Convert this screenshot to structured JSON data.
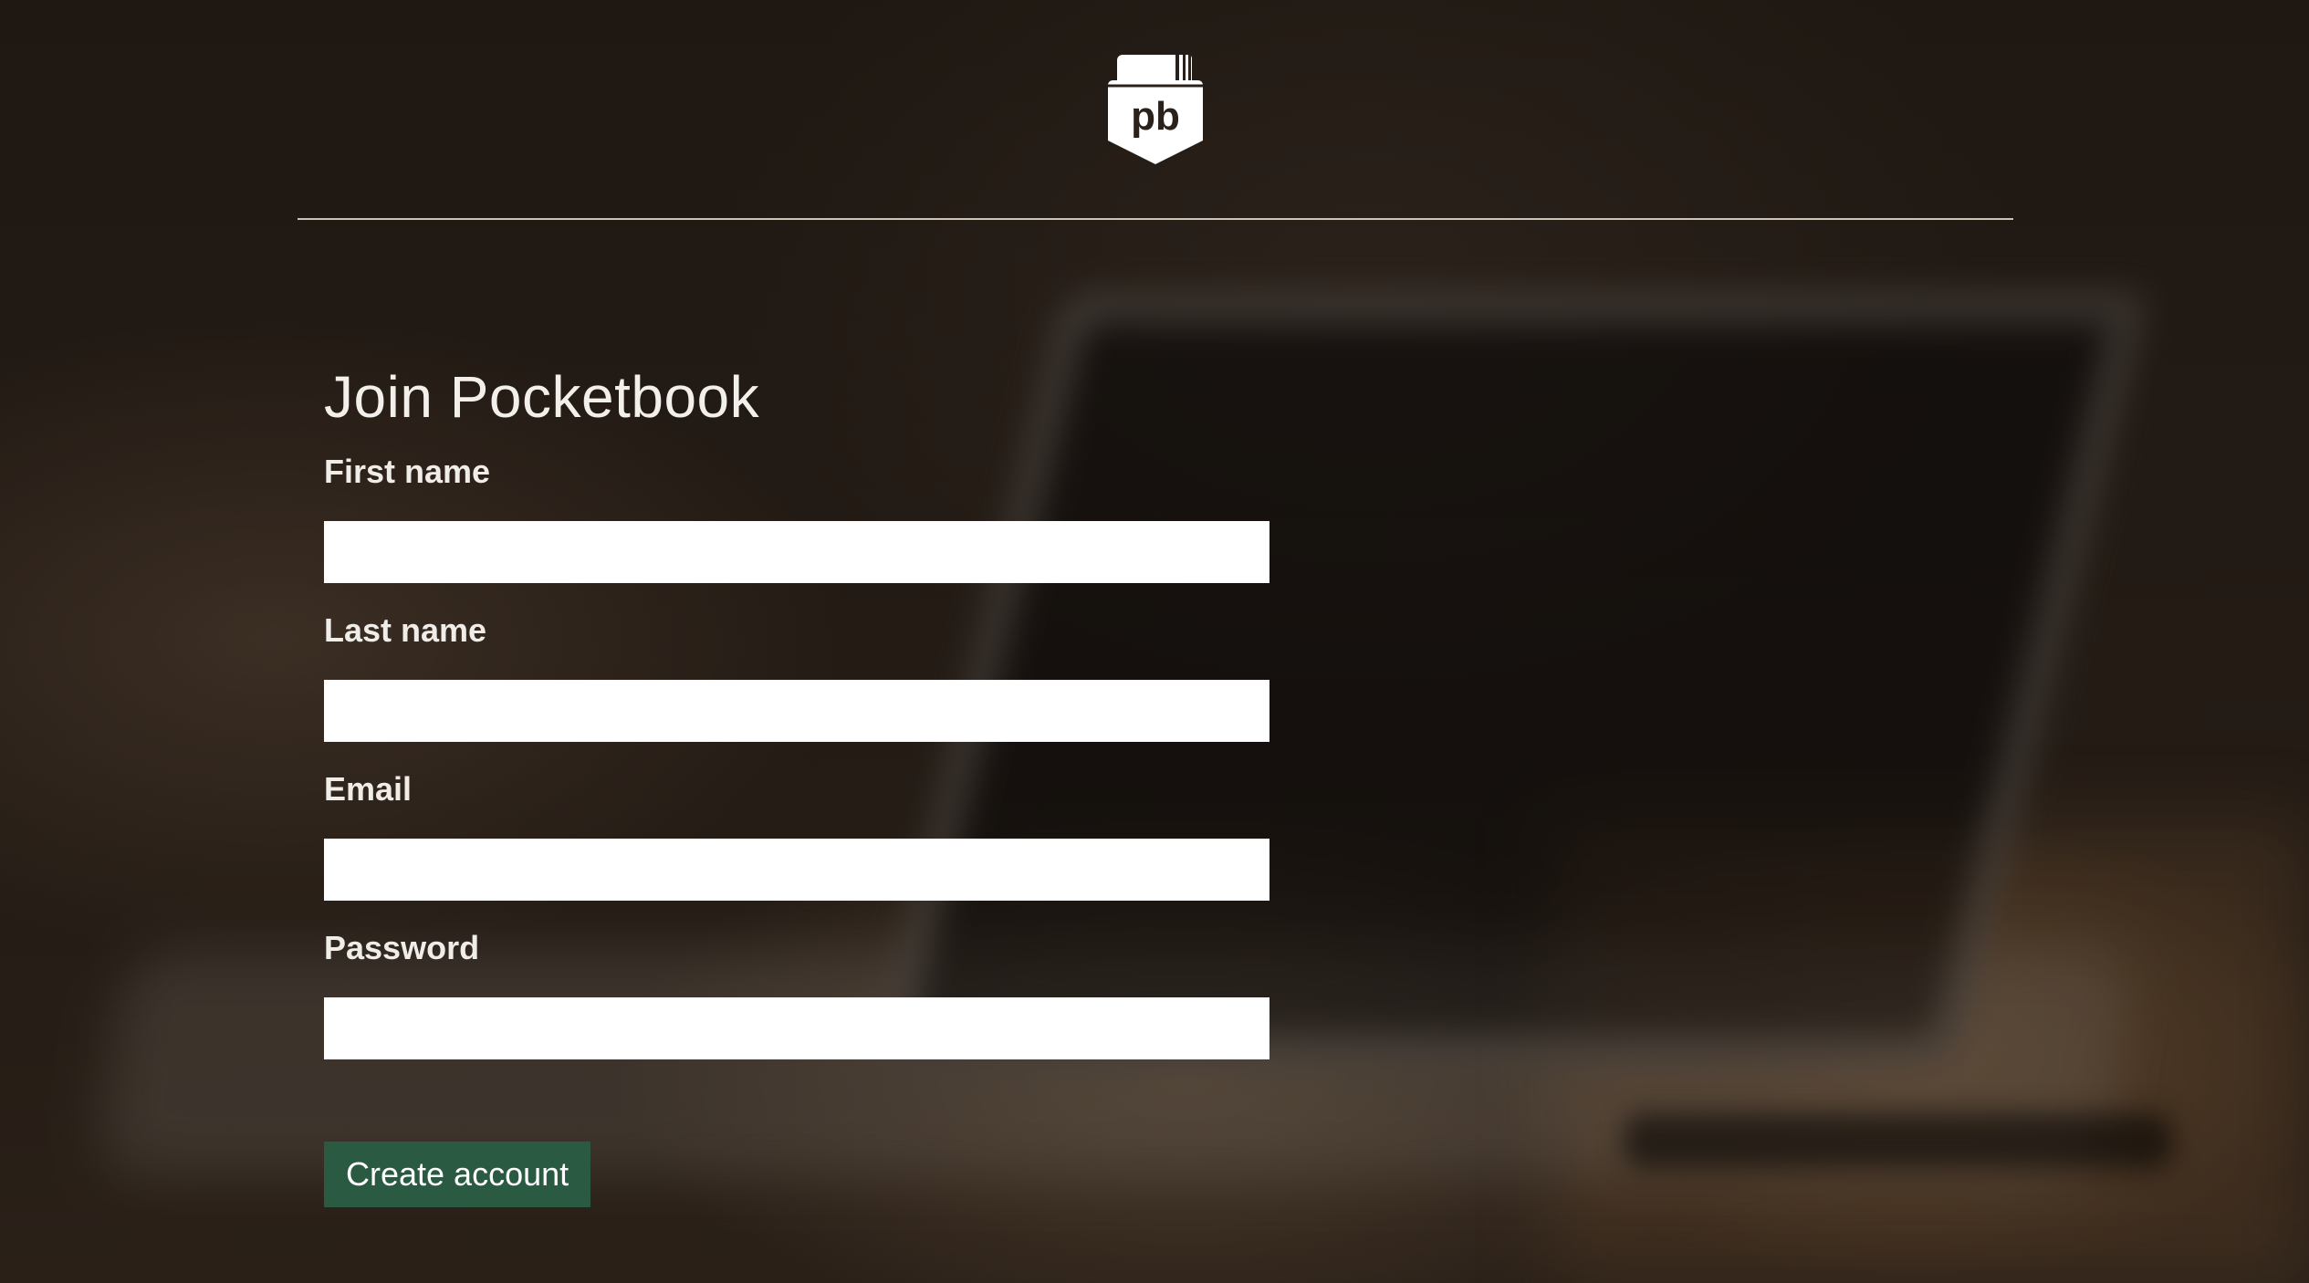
{
  "app": {
    "logo_text": "pb"
  },
  "signup": {
    "title": "Join Pocketbook",
    "fields": [
      {
        "label": "First name",
        "value": ""
      },
      {
        "label": "Last name",
        "value": ""
      },
      {
        "label": "Email",
        "value": ""
      },
      {
        "label": "Password",
        "value": ""
      }
    ],
    "submit_label": "Create account"
  },
  "colors": {
    "button_bg": "#2b5a43",
    "background": "#221a14",
    "text": "#f3f0ec"
  }
}
